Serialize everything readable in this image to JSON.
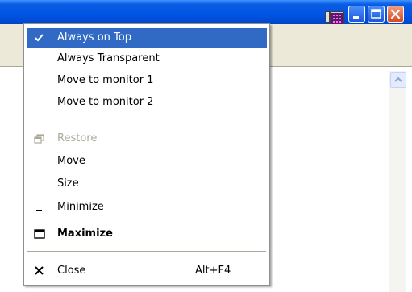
{
  "window": {
    "controls": {
      "minimize": "minimize-icon",
      "maximize": "maximize-icon",
      "close": "close-icon"
    }
  },
  "menu": {
    "items": [
      {
        "label": "Always on Top",
        "checked": true,
        "selected": true
      },
      {
        "label": "Always Transparent"
      },
      {
        "label": "Move to monitor 1"
      },
      {
        "label": "Move to monitor 2"
      },
      {
        "label": "Restore",
        "disabled": true,
        "icon": "restore-icon"
      },
      {
        "label": "Move"
      },
      {
        "label": "Size"
      },
      {
        "label": "Minimize",
        "icon": "minimize-icon"
      },
      {
        "label": "Maximize",
        "bold": true,
        "icon": "maximize-icon"
      },
      {
        "label": "Close",
        "shortcut": "Alt+F4",
        "icon": "close-icon"
      }
    ]
  },
  "colors": {
    "selection": "#316ac5",
    "titlebar": "#0055e5",
    "disabled_text": "#aca899"
  }
}
